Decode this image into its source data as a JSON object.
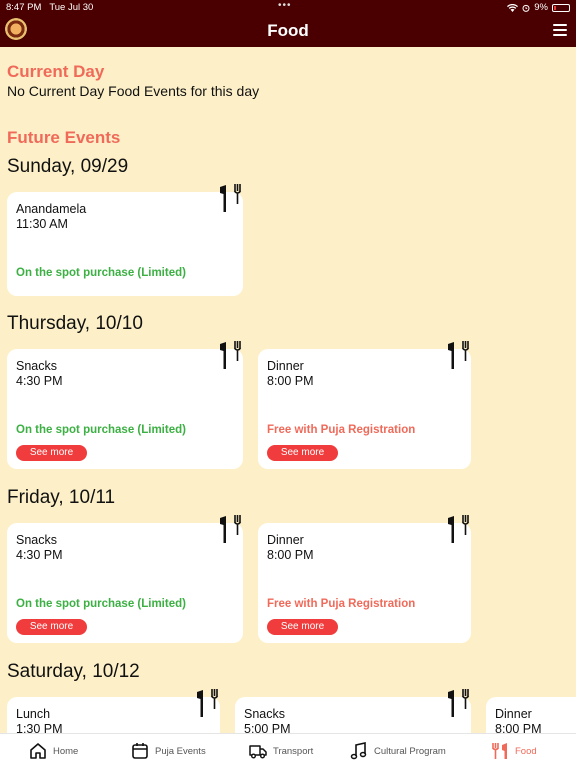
{
  "status": {
    "time": "8:47 PM",
    "date": "Tue Jul 30",
    "battery": "9%"
  },
  "header": {
    "title": "Food"
  },
  "current_day": {
    "heading": "Current Day",
    "message": "No Current Day Food Events for this day"
  },
  "future": {
    "heading": "Future Events"
  },
  "days": [
    {
      "label": "Sunday, 09/29",
      "events": [
        {
          "name": "Anandamela",
          "time": "11:30 AM",
          "note": "On the spot purchase (Limited)"
        }
      ]
    },
    {
      "label": "Thursday, 10/10",
      "events": [
        {
          "name": "Snacks",
          "time": "4:30 PM",
          "note": "On the spot purchase (Limited)",
          "button": "See more"
        },
        {
          "name": "Dinner",
          "time": "8:00 PM",
          "note": "Free with Puja Registration",
          "button": "See more"
        }
      ]
    },
    {
      "label": "Friday, 10/11",
      "events": [
        {
          "name": "Snacks",
          "time": "4:30 PM",
          "note": "On the spot purchase (Limited)",
          "button": "See more"
        },
        {
          "name": "Dinner",
          "time": "8:00 PM",
          "note": "Free with Puja Registration",
          "button": "See more"
        }
      ]
    },
    {
      "label": "Saturday, 10/12",
      "events": [
        {
          "name": "Lunch",
          "time": "1:30 PM"
        },
        {
          "name": "Snacks",
          "time": "5:00 PM"
        },
        {
          "name": "Dinner",
          "time": "8:00 PM"
        }
      ]
    }
  ],
  "tabs": [
    {
      "label": "Home",
      "icon": "home-icon"
    },
    {
      "label": "Puja Events",
      "icon": "calendar-icon"
    },
    {
      "label": "Transport",
      "icon": "truck-icon"
    },
    {
      "label": "Cultural Program",
      "icon": "music-note-icon"
    },
    {
      "label": "Food",
      "icon": "cutlery-icon",
      "active": true
    }
  ],
  "colors": {
    "header_bg": "#4a0000",
    "page_bg": "#fdf0c8",
    "accent": "#f06a5a",
    "green": "#3cb043",
    "button": "#f03c3c"
  }
}
